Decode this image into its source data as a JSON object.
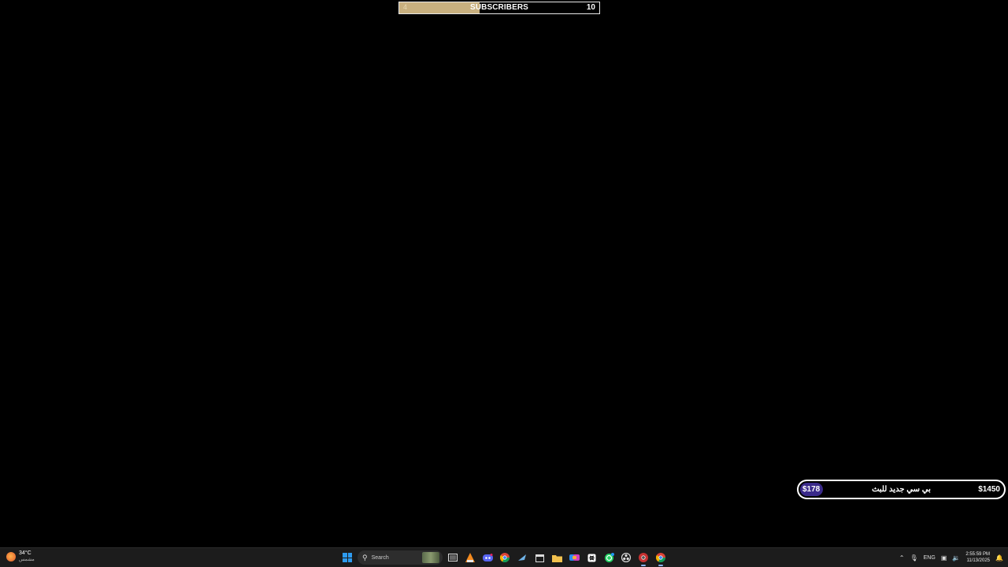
{
  "subscriber_goal": {
    "current": "4",
    "label": "SUBSCRIBERS",
    "target": "10",
    "progress": 0.4,
    "fill_color": "#c8b07f"
  },
  "donation_goal": {
    "current": "$178",
    "title": "بي سي جديد للبث",
    "target": "$1450",
    "progress": 0.123,
    "fill_color": "#3a2a8a"
  },
  "taskbar": {
    "weather": {
      "temp": "34°C",
      "condition": "مشمس",
      "icon": "sun-icon"
    },
    "search": {
      "placeholder": "Search"
    },
    "apps": [
      {
        "name": "start-button",
        "icon": "windows-logo-icon"
      },
      {
        "name": "task-view-button",
        "icon": "task-view-icon"
      },
      {
        "name": "app-vlc",
        "icon": "vlc-icon"
      },
      {
        "name": "app-discord",
        "icon": "discord-icon"
      },
      {
        "name": "app-chrome",
        "icon": "chrome-icon"
      },
      {
        "name": "app-steam",
        "icon": "steam-icon"
      },
      {
        "name": "app-calendar",
        "icon": "calendar-icon"
      },
      {
        "name": "app-file-explorer",
        "icon": "folder-icon"
      },
      {
        "name": "app-copilot",
        "icon": "copilot-icon"
      },
      {
        "name": "app-capcut",
        "icon": "capcut-icon"
      },
      {
        "name": "app-whatsapp",
        "icon": "whatsapp-icon"
      },
      {
        "name": "app-obs",
        "icon": "obs-icon"
      },
      {
        "name": "app-chrome-alt",
        "icon": "chrome-red-icon"
      },
      {
        "name": "app-chrome-active",
        "icon": "chrome-icon"
      }
    ],
    "tray": {
      "language": "ENG",
      "time": "2:55:59 PM",
      "date": "11/13/2025"
    }
  }
}
